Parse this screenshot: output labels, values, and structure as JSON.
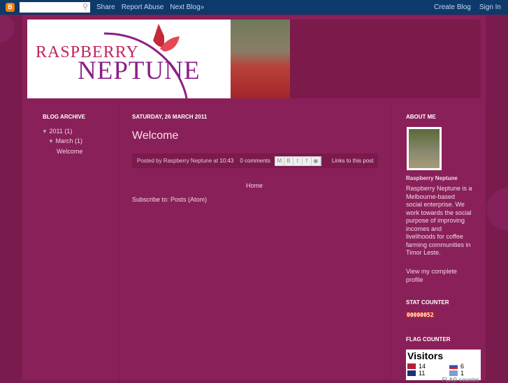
{
  "navbar": {
    "search_placeholder": "",
    "links": [
      "Share",
      "Report Abuse",
      "Next Blog»"
    ],
    "create": "Create Blog",
    "signin": "Sign In"
  },
  "header": {
    "logo_line1": "RASPBERRY",
    "logo_line2": "NEPTUNE"
  },
  "archive": {
    "title": "BLOG ARCHIVE",
    "year": "2011",
    "year_count": "(1)",
    "month": "March",
    "month_count": "(1)",
    "post": "Welcome"
  },
  "post": {
    "date": "SATURDAY, 26 MARCH 2011",
    "title": "Welcome",
    "posted_by": "Posted by Raspberry Neptune at",
    "time": "10:43",
    "comments": "0 comments",
    "links": "Links to this post",
    "home": "Home",
    "subscribe_label": "Subscribe to:",
    "subscribe_link": "Posts (Atom)"
  },
  "about": {
    "title": "ABOUT ME",
    "name": "Raspberry Neptune",
    "bio": "Raspberry Neptune is a Melbourne-based social enterprise. We work towards the social purpose of improving incomes and livelihoods for coffee farming communities in Timor Leste.",
    "profile_link": "View my complete profile"
  },
  "stat": {
    "title": "STAT COUNTER",
    "count": "00000052"
  },
  "flag": {
    "title": "FLAG COUNTER",
    "visitors": "Visitors",
    "rows": [
      [
        "14",
        "6"
      ],
      [
        "11",
        "1"
      ]
    ],
    "footer": "FLAG counter"
  }
}
